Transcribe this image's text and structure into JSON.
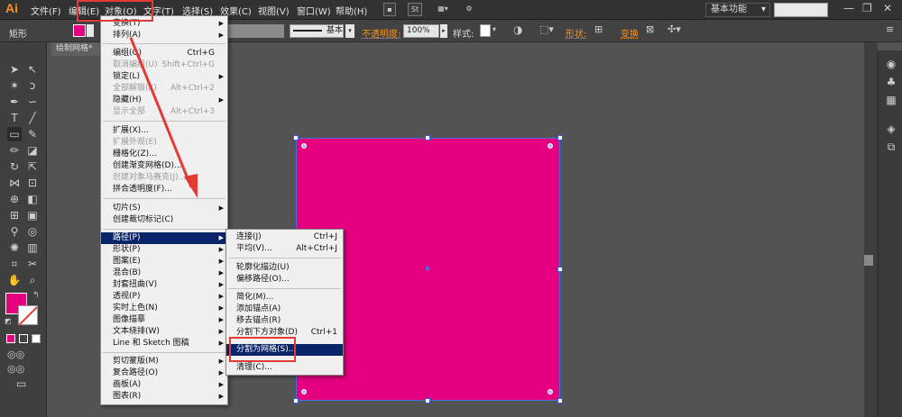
{
  "app": {
    "logo": "Ai"
  },
  "menubar": {
    "items": [
      "文件(F)",
      "编辑(E)",
      "对象(O)",
      "文字(T)",
      "选择(S)",
      "效果(C)",
      "视图(V)",
      "窗口(W)",
      "帮助(H)"
    ],
    "st_label": "St",
    "workspace": "基本功能",
    "workspace_arrow": "▾"
  },
  "controlbar": {
    "shape_label": "矩形",
    "stroke_profile": "基本",
    "opacity_label": "不透明度:",
    "opacity_value": "100%",
    "style_label": "样式:",
    "shape_link": "形状:",
    "transform_link": "变换"
  },
  "document": {
    "tab_label": "绘制网格*",
    "fill_color": "#e4007f"
  },
  "object_menu": {
    "items": [
      {
        "label": "变换(T)",
        "shortcut": "",
        "submenu": true,
        "disabled": false
      },
      {
        "label": "排列(A)",
        "shortcut": "",
        "submenu": true,
        "disabled": false
      },
      {
        "label": "编组(G)",
        "shortcut": "Ctrl+G",
        "submenu": false,
        "disabled": false
      },
      {
        "label": "取消编组(U)",
        "shortcut": "Shift+Ctrl+G",
        "submenu": false,
        "disabled": true
      },
      {
        "label": "锁定(L)",
        "shortcut": "",
        "submenu": true,
        "disabled": false
      },
      {
        "label": "全部解锁(K)",
        "shortcut": "Alt+Ctrl+2",
        "submenu": false,
        "disabled": true
      },
      {
        "label": "隐藏(H)",
        "shortcut": "",
        "submenu": true,
        "disabled": false
      },
      {
        "label": "显示全部",
        "shortcut": "Alt+Ctrl+3",
        "submenu": false,
        "disabled": true
      },
      {
        "label": "扩展(X)...",
        "shortcut": "",
        "submenu": false,
        "disabled": false
      },
      {
        "label": "扩展外观(E)",
        "shortcut": "",
        "submenu": false,
        "disabled": true
      },
      {
        "label": "栅格化(Z)...",
        "shortcut": "",
        "submenu": false,
        "disabled": false
      },
      {
        "label": "创建渐变网格(D)...",
        "shortcut": "",
        "submenu": false,
        "disabled": false
      },
      {
        "label": "创建对象马赛克(J)...",
        "shortcut": "",
        "submenu": false,
        "disabled": true
      },
      {
        "label": "拼合透明度(F)...",
        "shortcut": "",
        "submenu": false,
        "disabled": false
      },
      {
        "label": "切片(S)",
        "shortcut": "",
        "submenu": true,
        "disabled": false
      },
      {
        "label": "创建裁切标记(C)",
        "shortcut": "",
        "submenu": false,
        "disabled": false
      },
      {
        "label": "路径(P)",
        "shortcut": "",
        "submenu": true,
        "disabled": false
      },
      {
        "label": "形状(P)",
        "shortcut": "",
        "submenu": true,
        "disabled": false
      },
      {
        "label": "图案(E)",
        "shortcut": "",
        "submenu": true,
        "disabled": false
      },
      {
        "label": "混合(B)",
        "shortcut": "",
        "submenu": true,
        "disabled": false
      },
      {
        "label": "封套扭曲(V)",
        "shortcut": "",
        "submenu": true,
        "disabled": false
      },
      {
        "label": "透视(P)",
        "shortcut": "",
        "submenu": true,
        "disabled": false
      },
      {
        "label": "实时上色(N)",
        "shortcut": "",
        "submenu": true,
        "disabled": false
      },
      {
        "label": "图像描摹",
        "shortcut": "",
        "submenu": true,
        "disabled": false
      },
      {
        "label": "文本绕排(W)",
        "shortcut": "",
        "submenu": true,
        "disabled": false
      },
      {
        "label": "Line 和 Sketch 图稿",
        "shortcut": "",
        "submenu": true,
        "disabled": false
      },
      {
        "label": "剪切蒙版(M)",
        "shortcut": "",
        "submenu": true,
        "disabled": false
      },
      {
        "label": "复合路径(O)",
        "shortcut": "",
        "submenu": true,
        "disabled": false
      },
      {
        "label": "画板(A)",
        "shortcut": "",
        "submenu": true,
        "disabled": false
      },
      {
        "label": "图表(R)",
        "shortcut": "",
        "submenu": true,
        "disabled": false
      }
    ]
  },
  "path_submenu": {
    "items": [
      {
        "label": "连接(J)",
        "shortcut": "Ctrl+J"
      },
      {
        "label": "平均(V)...",
        "shortcut": "Alt+Ctrl+J"
      },
      {
        "label": "轮廓化描边(U)",
        "shortcut": ""
      },
      {
        "label": "偏移路径(O)...",
        "shortcut": ""
      },
      {
        "label": "简化(M)...",
        "shortcut": ""
      },
      {
        "label": "添加锚点(A)",
        "shortcut": ""
      },
      {
        "label": "移去锚点(R)",
        "shortcut": ""
      },
      {
        "label": "分割下方对象(D)",
        "shortcut": "Ctrl+1"
      },
      {
        "label": "分割为网格(S)...",
        "shortcut": ""
      },
      {
        "label": "清理(C)...",
        "shortcut": ""
      }
    ]
  },
  "annotation": {
    "color": "#e53935"
  }
}
